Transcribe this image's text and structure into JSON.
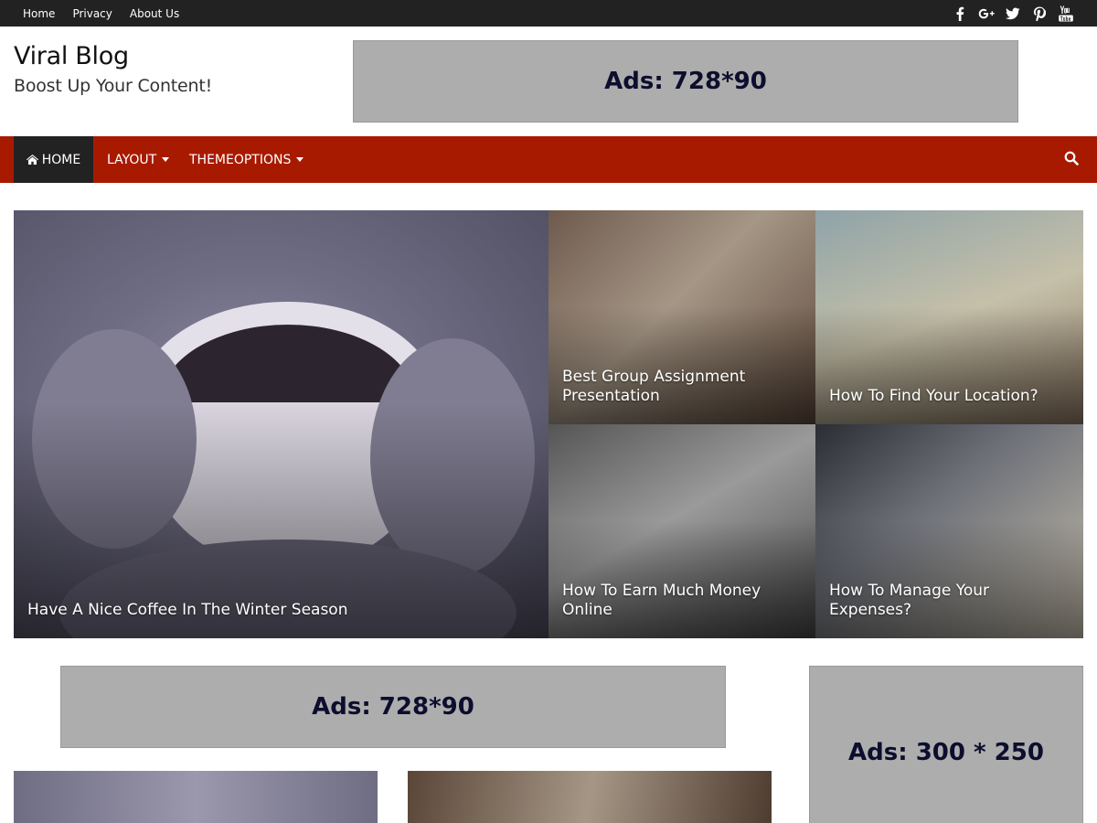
{
  "topbar": {
    "links": [
      "Home",
      "Privacy",
      "About Us"
    ],
    "social_icons": [
      "facebook-icon",
      "google-plus-icon",
      "twitter-icon",
      "pinterest-icon",
      "youtube-icon"
    ]
  },
  "header": {
    "site_title": "Viral Blog",
    "tagline": "Boost Up Your Content!",
    "ad_label": "Ads: 728*90"
  },
  "nav": {
    "home": "HOME",
    "layout": "LAYOUT",
    "themeoptions": "THEMEOPTIONS",
    "home_icon": "home-icon",
    "search_icon": "search-icon"
  },
  "featured": {
    "big": "Have A Nice Coffee In The Winter Season",
    "a": "Best Group Assignment Presentation",
    "b": "How To Find Your Location?",
    "c": "How To Earn Much Money Online",
    "d": "How To Manage Your Expenses?"
  },
  "ads": {
    "mid": "Ads: 728*90",
    "side": "Ads: 300 * 250"
  },
  "colors": {
    "topbar": "#222222",
    "nav": "#a81a00",
    "ad_bg": "#adadad"
  }
}
